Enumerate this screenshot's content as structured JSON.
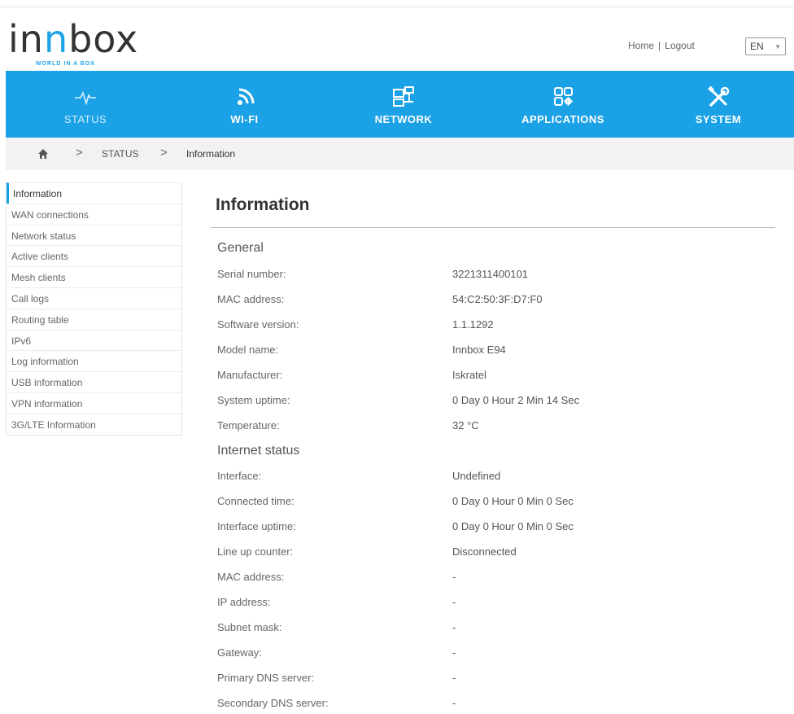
{
  "brand": {
    "logo_text_left": "in",
    "logo_text_accent": "n",
    "logo_text_right": "box",
    "tagline": "WORLD IN A BOX",
    "accent_color": "#1ba1e6"
  },
  "top_links": {
    "home": "Home",
    "separator": "|",
    "logout": "Logout"
  },
  "language": {
    "selected": "EN"
  },
  "nav": [
    {
      "label": "STATUS",
      "icon": "pulse-icon",
      "active": true
    },
    {
      "label": "WI-FI",
      "icon": "wifi-icon",
      "active": false
    },
    {
      "label": "NETWORK",
      "icon": "network-icon",
      "active": false
    },
    {
      "label": "APPLICATIONS",
      "icon": "apps-icon",
      "active": false
    },
    {
      "label": "SYSTEM",
      "icon": "tools-icon",
      "active": false
    }
  ],
  "breadcrumb": {
    "level1": "STATUS",
    "level2": "Information"
  },
  "sidebar": {
    "items": [
      "Information",
      "WAN connections",
      "Network status",
      "Active clients",
      "Mesh clients",
      "Call logs",
      "Routing table",
      "IPv6",
      "Log information",
      "USB information",
      "VPN information",
      "3G/LTE Information"
    ],
    "active_index": 0
  },
  "page": {
    "title": "Information"
  },
  "general": {
    "title": "General",
    "rows": [
      {
        "label": "Serial number:",
        "value": "3221311400101"
      },
      {
        "label": "MAC address:",
        "value": "54:C2:50:3F:D7:F0"
      },
      {
        "label": "Software version:",
        "value": "1.1.1292"
      },
      {
        "label": "Model name:",
        "value": "Innbox E94"
      },
      {
        "label": "Manufacturer:",
        "value": "Iskratel"
      },
      {
        "label": "System uptime:",
        "value": "0 Day 0 Hour 2 Min 14 Sec"
      },
      {
        "label": "Temperature:",
        "value": "32 °C"
      }
    ]
  },
  "internet": {
    "title": "Internet status",
    "rows": [
      {
        "label": "Interface:",
        "value": "Undefined"
      },
      {
        "label": "Connected time:",
        "value": "0 Day 0 Hour 0 Min 0 Sec"
      },
      {
        "label": "Interface uptime:",
        "value": "0 Day 0 Hour 0 Min 0 Sec"
      },
      {
        "label": "Line up counter:",
        "value": "Disconnected"
      },
      {
        "label": "MAC address:",
        "value": "-"
      },
      {
        "label": "IP address:",
        "value": "-"
      },
      {
        "label": "Subnet mask:",
        "value": "-"
      },
      {
        "label": "Gateway:",
        "value": "-"
      },
      {
        "label": "Primary DNS server:",
        "value": "-"
      },
      {
        "label": "Secondary DNS server:",
        "value": "-"
      }
    ]
  }
}
